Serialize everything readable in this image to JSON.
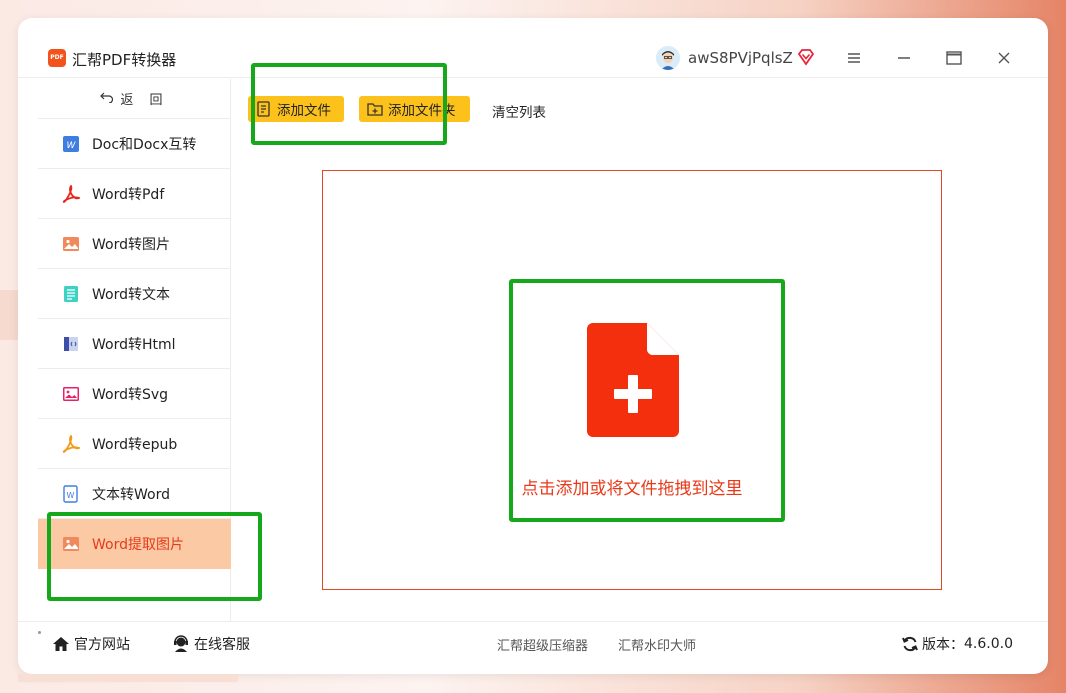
{
  "app": {
    "title": "汇帮PDF转换器",
    "logo_text": "PDF",
    "username": "awS8PVjPqlsZ"
  },
  "window_controls": [
    "menu-icon",
    "minimize-icon",
    "maximize-icon",
    "close-icon"
  ],
  "sidebar": {
    "back_label": "返 回",
    "items": [
      {
        "label": "Doc和Docx互转",
        "icon": "word-doc-icon",
        "active": false
      },
      {
        "label": "Word转Pdf",
        "icon": "pdf-icon",
        "active": false
      },
      {
        "label": "Word转图片",
        "icon": "image-icon",
        "active": false
      },
      {
        "label": "Word转文本",
        "icon": "text-file-icon",
        "active": false
      },
      {
        "label": "Word转Html",
        "icon": "html-icon",
        "active": false
      },
      {
        "label": "Word转Svg",
        "icon": "svg-image-icon",
        "active": false
      },
      {
        "label": "Word转epub",
        "icon": "epub-icon",
        "active": false
      },
      {
        "label": "文本转Word",
        "icon": "word-doc-icon",
        "active": false
      },
      {
        "label": "Word提取图片",
        "icon": "image-icon",
        "active": true
      }
    ]
  },
  "toolbar": {
    "add_file": "添加文件",
    "add_folder": "添加文件夹",
    "clear_list": "清空列表"
  },
  "dropzone": {
    "text": "点击添加或将文件拖拽到这里"
  },
  "footer": {
    "official_site": "官方网站",
    "online_service": "在线客服",
    "compressor": "汇帮超级压缩器",
    "watermark": "汇帮水印大师",
    "version_label": "版本：",
    "version": "4.6.0.0"
  },
  "colors": {
    "accent_yellow": "#fcc21b",
    "accent_red": "#f42f0d",
    "active_bg": "#fbc9a3",
    "highlight_green": "#16a81b"
  }
}
